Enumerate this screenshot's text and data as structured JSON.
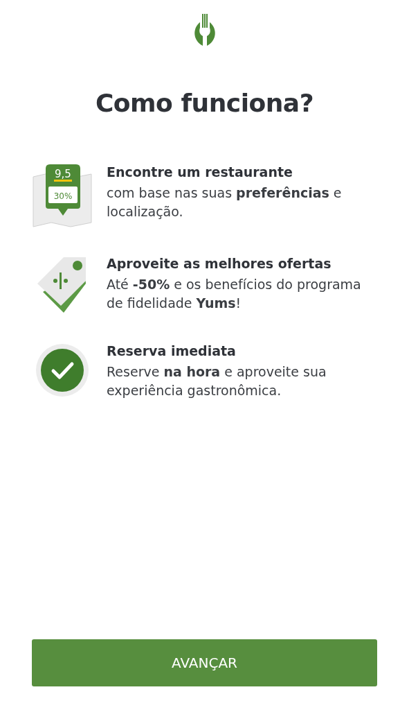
{
  "title": "Como funciona?",
  "features": [
    {
      "kind": "map",
      "score": "9,5",
      "discount": "30%",
      "heading": "Encontre um restaurante",
      "text": "com base nas suas **preferências** e localização."
    },
    {
      "kind": "tag",
      "heading": "Aproveite as melhores ofertas",
      "text": "Até **-50%** e os benefícios do programa de fidelidade **Yums**!"
    },
    {
      "kind": "check",
      "heading": "Reserva imediata",
      "text": "Reserve **na hora** e aproveite sua experiência gastronômica."
    }
  ],
  "button": "AVANÇAR"
}
